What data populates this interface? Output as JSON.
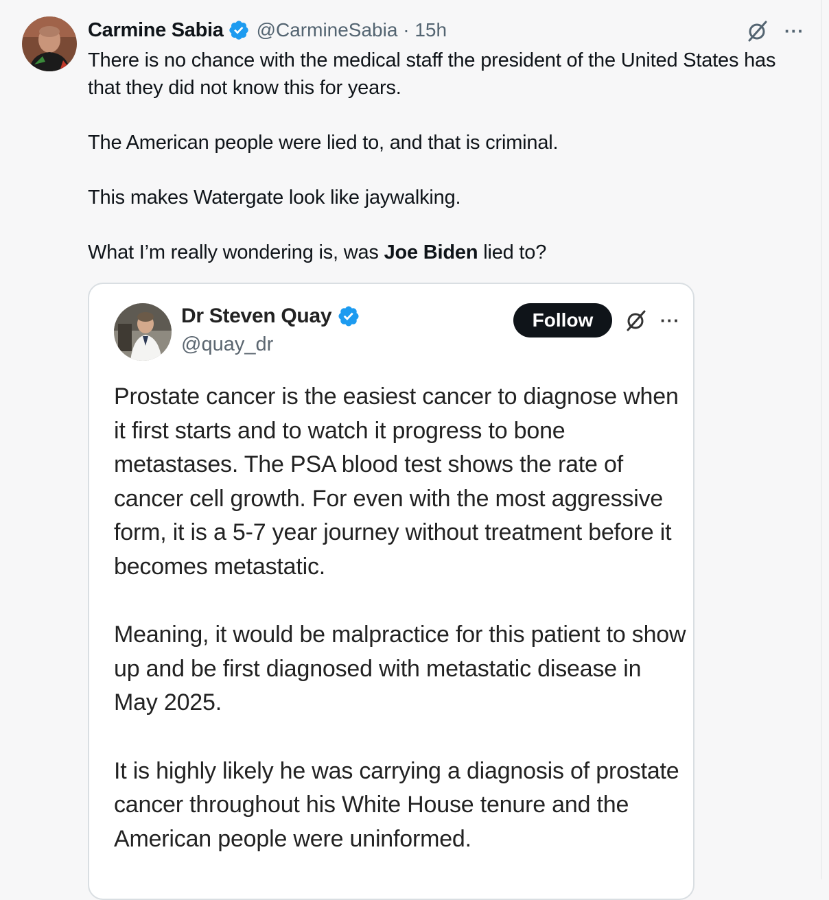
{
  "tweet": {
    "author_name": "Carmine Sabia",
    "handle": "@CarmineSabia",
    "separator": "·",
    "time": "15h",
    "paragraphs": [
      "There is no chance with the medical staff the president of the United States has that they did not know this for years.",
      "The American people were lied to, and that is criminal.",
      "This makes Watergate look like jaywalking."
    ],
    "last_paragraph_before": "What I’m really wondering is, was ",
    "last_paragraph_bold": "Joe Biden",
    "last_paragraph_after": " lied to?",
    "more_label": "···"
  },
  "quoted": {
    "author_name": "Dr Steven Quay",
    "handle": "@quay_dr",
    "follow_label": "Follow",
    "more_label": "···",
    "paragraphs": [
      "Prostate cancer is the easiest cancer to diagnose when it first starts and to watch it progress to bone metastases. The PSA blood test shows the rate of cancer cell growth. For even with the most aggressive form, it is a 5-7 year journey without treatment before it becomes metastatic.",
      "Meaning, it would be malpractice for this patient to show up and be first diagnosed with metastatic disease in May 2025.",
      "It is highly likely he was carrying a diagnosis of prostate cancer throughout his White House tenure and the American people were uninformed."
    ]
  },
  "colors": {
    "background": "#f7f7f8",
    "text": "#0f1419",
    "secondary_text": "#536471",
    "verified_blue": "#1d9bf0",
    "follow_button": "#0f1419"
  },
  "icons": [
    "verified-badge-icon",
    "grok-icon",
    "more-icon"
  ]
}
